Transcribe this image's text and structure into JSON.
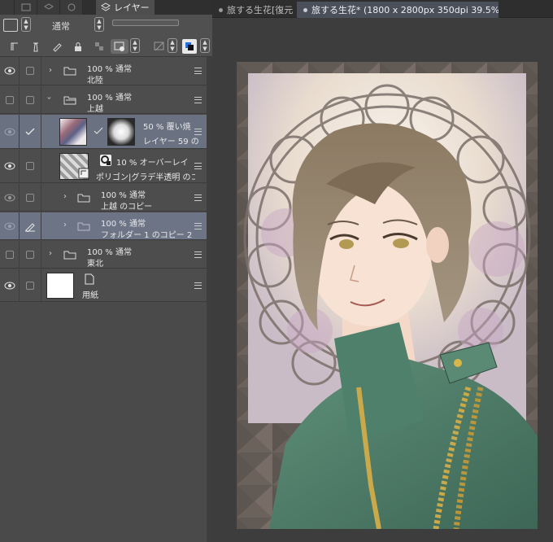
{
  "layer_panel": {
    "tab_label": "レイヤー",
    "blend_mode": "通常",
    "layers": [
      {
        "percent": "100 %",
        "mode": "通常",
        "name": "北陸",
        "expanded": false
      },
      {
        "percent": "100 %",
        "mode": "通常",
        "name": "上越",
        "expanded": true
      },
      {
        "percent": "50 %",
        "mode": "覆い焼",
        "name": "レイヤー 59 の"
      },
      {
        "percent": "10 %",
        "mode": "オーバーレイ",
        "name": "ポリゴン|グラデ半透明 のコピー"
      },
      {
        "percent": "100 %",
        "mode": "通常",
        "name": "上越 のコピー",
        "expanded": false
      },
      {
        "percent": "100 %",
        "mode": "通常",
        "name": "フォルダー 1 のコピー 2",
        "expanded": false
      },
      {
        "percent": "100 %",
        "mode": "通常",
        "name": "東北",
        "expanded": false
      },
      {
        "name": "用紙"
      }
    ]
  },
  "document_tabs": [
    {
      "label": "旅する生花[復元",
      "active": false
    },
    {
      "label": "旅する生花* (1800 x 2800px 350dpi 39.5%)",
      "active": true
    }
  ],
  "colors": {
    "panel_bg": "#4a4a4a",
    "selected_row": "#6a7180",
    "canvas_bg": "#3d3d3d",
    "uniform_green": "#4a7a66",
    "gold_trim": "#c9a94a"
  }
}
